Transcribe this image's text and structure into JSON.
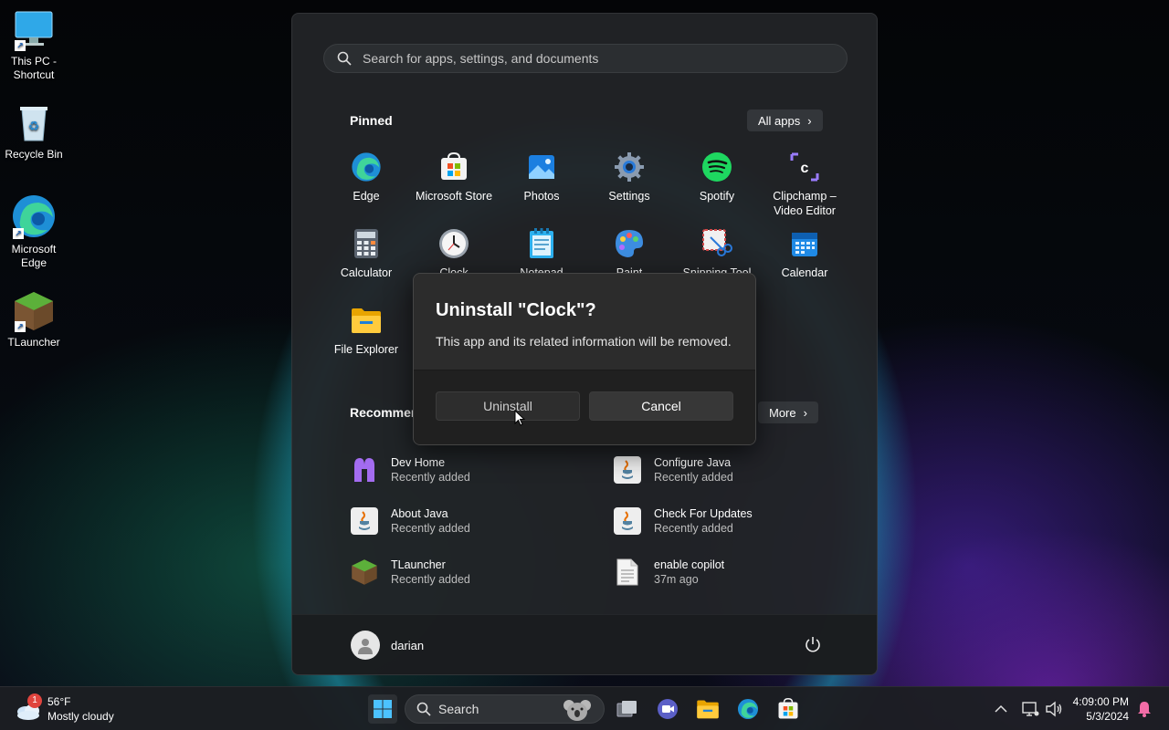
{
  "desktop": {
    "icons": [
      {
        "label": "This PC - Shortcut",
        "icon": "monitor-icon"
      },
      {
        "label": "Recycle Bin",
        "icon": "recycle-bin-icon"
      },
      {
        "label": "Microsoft Edge",
        "icon": "edge-icon"
      },
      {
        "label": "TLauncher",
        "icon": "tlauncher-icon"
      }
    ]
  },
  "start_menu": {
    "search_placeholder": "Search for apps, settings, and documents",
    "pinned_title": "Pinned",
    "all_apps_label": "All apps",
    "pinned": [
      {
        "label": "Edge",
        "icon": "edge-icon"
      },
      {
        "label": "Microsoft Store",
        "icon": "store-icon"
      },
      {
        "label": "Photos",
        "icon": "photos-icon"
      },
      {
        "label": "Settings",
        "icon": "gear-icon"
      },
      {
        "label": "Spotify",
        "icon": "spotify-icon"
      },
      {
        "label": "Clipchamp – Video Editor",
        "icon": "clipchamp-icon"
      },
      {
        "label": "Calculator",
        "icon": "calculator-icon"
      },
      {
        "label": "Clock",
        "icon": "clock-icon"
      },
      {
        "label": "Notepad",
        "icon": "notepad-icon"
      },
      {
        "label": "Paint",
        "icon": "paint-icon"
      },
      {
        "label": "Snipping Tool",
        "icon": "snipping-tool-icon"
      },
      {
        "label": "Calendar",
        "icon": "calendar-icon"
      },
      {
        "label": "File Explorer",
        "icon": "folder-icon"
      }
    ],
    "recommended_title": "Recommen",
    "more_label": "More",
    "recommended": [
      {
        "title": "Dev Home",
        "sub": "Recently added",
        "icon": "dev-home-icon"
      },
      {
        "title": "Configure Java",
        "sub": "Recently added",
        "icon": "java-icon"
      },
      {
        "title": "About Java",
        "sub": "Recently added",
        "icon": "java-icon"
      },
      {
        "title": "Check For Updates",
        "sub": "Recently added",
        "icon": "java-icon"
      },
      {
        "title": "TLauncher",
        "sub": "Recently added",
        "icon": "tlauncher-icon"
      },
      {
        "title": "enable copilot",
        "sub": "37m ago",
        "icon": "document-icon"
      }
    ],
    "user_name": "darian"
  },
  "dialog": {
    "title": "Uninstall \"Clock\"?",
    "message": "This app and its related information will be removed.",
    "uninstall_label": "Uninstall",
    "cancel_label": "Cancel"
  },
  "taskbar": {
    "weather_temp": "56°F",
    "weather_desc": "Mostly cloudy",
    "weather_badge": "1",
    "search_label": "Search",
    "time": "4:09:00 PM",
    "date": "5/3/2024"
  }
}
